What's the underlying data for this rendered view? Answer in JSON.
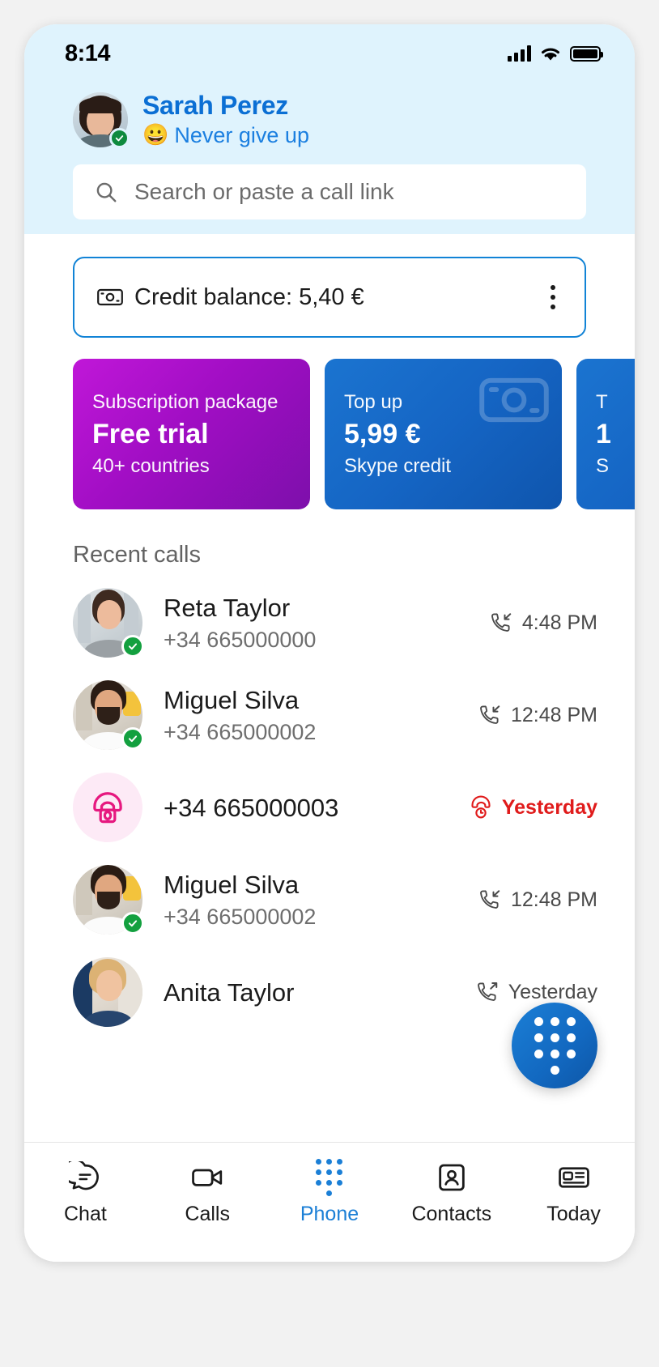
{
  "status_bar": {
    "time": "8:14",
    "signal_icon": "cellular-signal-icon",
    "wifi_icon": "wifi-icon",
    "battery_icon": "battery-full-icon"
  },
  "profile": {
    "name": "Sarah Perez",
    "mood_emoji": "😀",
    "mood_text": "Never give up",
    "presence": "available"
  },
  "search": {
    "placeholder": "Search or paste a call link",
    "icon": "search-icon"
  },
  "credit": {
    "icon": "banknote-icon",
    "label": "Credit balance: 5,40 €",
    "menu_icon": "more-vertical-icon"
  },
  "promo_cards": [
    {
      "top": "Subscription package",
      "middle": "Free trial",
      "bottom": "40+ countries",
      "color": "#a10ec4",
      "icon": ""
    },
    {
      "top": "Top up",
      "middle": "5,99 €",
      "bottom": "Skype credit",
      "color": "#1565c4",
      "icon": "banknote-icon"
    },
    {
      "top": "T",
      "middle": "1",
      "bottom": "S",
      "color": "#1565c4",
      "icon": "banknote-icon"
    }
  ],
  "recent_calls": {
    "section_title": "Recent calls",
    "rows": [
      {
        "name": "Reta Taylor",
        "number": "+34 665000000",
        "time": "4:48 PM",
        "direction": "incoming",
        "direction_icon": "call-incoming-icon",
        "missed": false,
        "avatar": "photo-woman-brunette",
        "presence": "available"
      },
      {
        "name": "Miguel Silva",
        "number": "+34 665000002",
        "time": "12:48 PM",
        "direction": "incoming",
        "direction_icon": "call-incoming-icon",
        "missed": false,
        "avatar": "photo-man-beard",
        "presence": "available"
      },
      {
        "name": "",
        "number": "+34 665000003",
        "time": "Yesterday",
        "direction": "missed",
        "direction_icon": "call-missed-icon",
        "missed": true,
        "avatar": "phone-icon-pink",
        "presence": "none"
      },
      {
        "name": "Miguel Silva",
        "number": "+34 665000002",
        "time": "12:48 PM",
        "direction": "incoming",
        "direction_icon": "call-incoming-icon",
        "missed": false,
        "avatar": "photo-man-beard",
        "presence": "available"
      },
      {
        "name": "Anita Taylor",
        "number": "",
        "time": "Yesterday",
        "direction": "outgoing",
        "direction_icon": "call-outgoing-icon",
        "missed": false,
        "avatar": "photo-woman-blonde",
        "presence": "none"
      }
    ]
  },
  "dialpad_fab": {
    "icon": "dialpad-icon"
  },
  "tabbar": {
    "items": [
      {
        "label": "Chat",
        "icon": "chat-bubble-icon",
        "active": false
      },
      {
        "label": "Calls",
        "icon": "video-camera-icon",
        "active": false
      },
      {
        "label": "Phone",
        "icon": "dialpad-icon",
        "active": true
      },
      {
        "label": "Contacts",
        "icon": "contact-card-icon",
        "active": false
      },
      {
        "label": "Today",
        "icon": "news-icon",
        "active": false
      }
    ]
  },
  "colors": {
    "header_bg": "#dff3fd",
    "accent_blue": "#1b7fd6",
    "link_blue": "#0b6fd4",
    "missed_red": "#e01b1b",
    "purple": "#a10ec4"
  }
}
